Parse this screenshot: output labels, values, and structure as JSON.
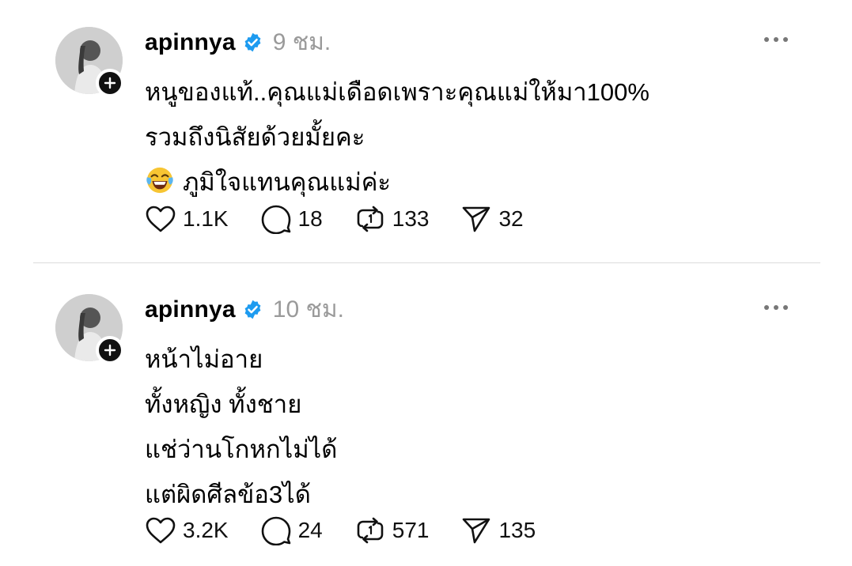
{
  "posts": [
    {
      "username": "apinnya",
      "time": "9 ชม.",
      "lines": [
        "หนูของแท้..คุณแม่เดือดเพราะคุณแม่ให้มา100%",
        "รวมถึงนิสัยด้วยมั้ยคะ",
        "ภูมิใจแทนคุณแม่ค่ะ"
      ],
      "emoji_icon": "face-with-tears-of-joy-emoji",
      "likes": "1.1K",
      "comments": "18",
      "reposts": "133",
      "shares": "32"
    },
    {
      "username": "apinnya",
      "time": "10 ชม.",
      "lines": [
        "หน้าไม่อาย",
        "ทั้งหญิง ทั้งชาย",
        "แช่ว่านโกหกไม่ได้",
        "แต่ผิดศีลข้อ3ได้"
      ],
      "likes": "3.2K",
      "comments": "24",
      "reposts": "571",
      "shares": "135"
    }
  ],
  "colors": {
    "verified": "#1d9bf0",
    "time": "#9a9a9a",
    "divider": "#dcdcdc"
  }
}
